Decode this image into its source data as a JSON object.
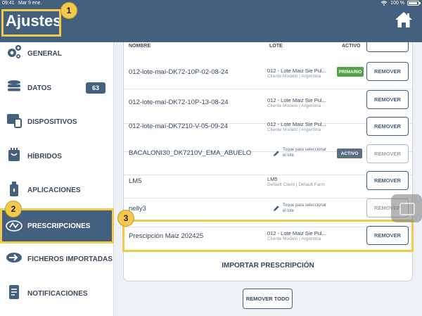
{
  "status_bar": {
    "time": "09:41",
    "date": "Mar 9 ene.",
    "battery": "100 %"
  },
  "header": {
    "title": "Ajustes",
    "home_icon": "home-icon"
  },
  "callouts": [
    "1",
    "2",
    "3"
  ],
  "sidebar": {
    "items": [
      {
        "label": "GENERAL",
        "icon": "gears-icon"
      },
      {
        "label": "DATOS",
        "icon": "database-icon",
        "badge": "63"
      },
      {
        "label": "DISPOSITIVOS",
        "icon": "devices-icon"
      },
      {
        "label": "HÍBRIDOS",
        "icon": "hybrids-icon"
      },
      {
        "label": "APLICACIONES",
        "icon": "applications-icon"
      },
      {
        "label": "PRESCRIPCIONES",
        "icon": "prescription-icon",
        "active": true
      },
      {
        "label": "FICHEROS IMPORTADAS",
        "icon": "import-files-icon"
      },
      {
        "label": "NOTIFICACIONES",
        "icon": "notifications-icon"
      }
    ]
  },
  "table": {
    "columns": {
      "name": "NOMBRE",
      "lote": "LOTE",
      "active": "ACTIVO"
    },
    "rows": [
      {
        "name": "012-lote-maí-DK72-10P-02-08-24",
        "lote": "012 - Lote Maiz Sie Pul...",
        "lote_sub": "Cliente Modelo | Argentina",
        "badge": "PRIMARIO",
        "action": "REMOVER"
      },
      {
        "name": "012-lote-maí-DK72-10P-13-08-24",
        "lote": "012 - Lote Maiz Sie Pul...",
        "lote_sub": "Cliente Modelo | Argentina",
        "action": "REMOVER"
      },
      {
        "name": "012-lote-maí-DK7210-V-05-09-24",
        "lote": "012 - Lote Maiz Sie Pul...",
        "lote_sub": "Cliente Modelo | Argentina",
        "action": "REMOVER"
      },
      {
        "name": "BACALONI30_DK7210V_EMA_ABUELO",
        "lote_hint": [
          "Toque para seleccionar",
          "el lote"
        ],
        "badge": "ACTIVO",
        "action": "REMOVER",
        "disabled": true
      },
      {
        "name": "LM5",
        "lote": "LM5",
        "lote_sub": "Default Client | Default Farm",
        "action": "REMOVER"
      },
      {
        "name": "nelly3",
        "lote_hint": [
          "Toque para seleccionar",
          "el lote"
        ],
        "action": "REMOVER",
        "disabled": true
      },
      {
        "name": "Prescipción Maiz 202425",
        "lote": "012 - Lote Maiz Sie Pul...",
        "lote_sub": "Cliente Modelo | Argentina",
        "action": "REMOVER"
      }
    ]
  },
  "import_label": "IMPORTAR PRESCRIPCIÓN",
  "remove_all_label": "REMOVER TODO",
  "colors": {
    "header": "#44607f",
    "highlight": "#f2c94c",
    "primary_badge": "#51a548",
    "active_badge": "#5a6e85"
  }
}
